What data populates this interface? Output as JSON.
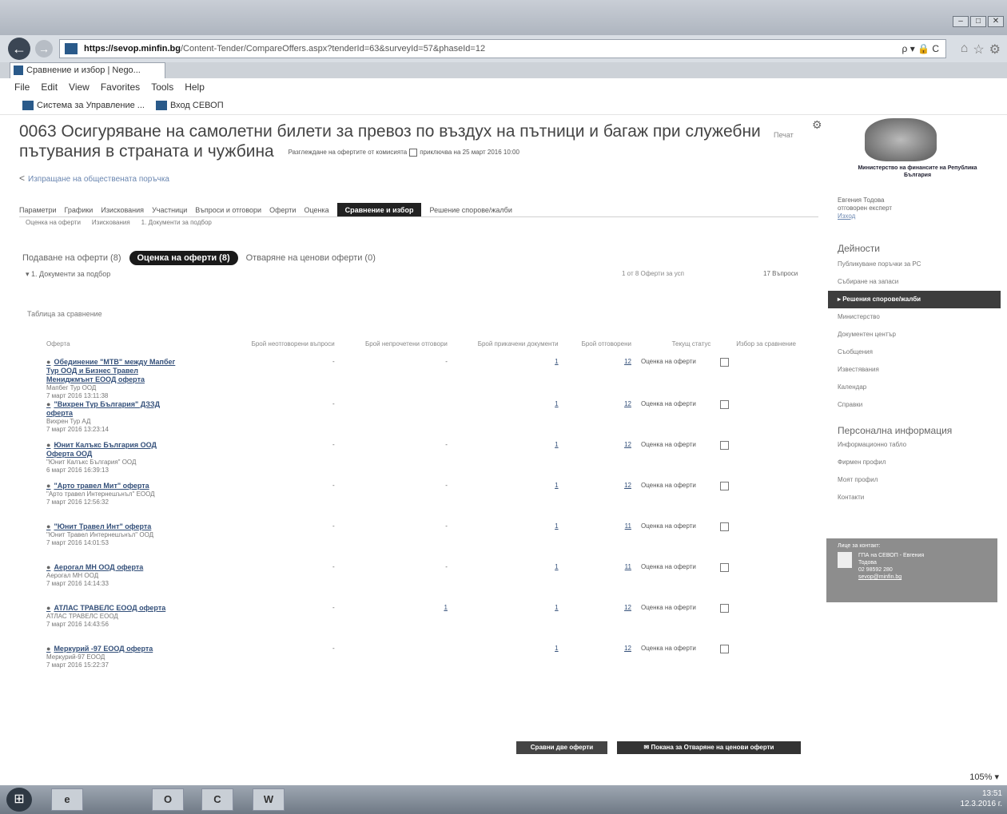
{
  "browser": {
    "url_host": "https://sevop.minfin.bg",
    "url_rest": "/Content-Tender/CompareOffers.aspx?tenderId=63&surveyId=57&phaseId=12",
    "url_tools": "ρ ▾ 🔒 C",
    "tab_title": "Сравнение и избор | Nego...",
    "menu": [
      "File",
      "Edit",
      "View",
      "Favorites",
      "Tools",
      "Help"
    ],
    "favorites": [
      "Система за Управление ...",
      "Вход СЕВОП"
    ],
    "zoom": "105%"
  },
  "page": {
    "title": "0063 Осигуряване на самолетни билети за превоз по въздух на пътници и багаж при служебни пътувания в страната и чужбина",
    "subline_a": "Разглеждане на офертите от комисията",
    "subline_b": "приключва на 25 март 2016 10:00",
    "print_link": "Печат",
    "share_link": "Изпращане на обществената поръчка",
    "tabs": [
      "Параметри",
      "Графики",
      "Изискования",
      "Участници",
      "Въпроси и отговори",
      "Оферти",
      "Оценка",
      "Сравнение и избор",
      "Решение спорове/жалби"
    ],
    "active_tab": "Сравнение и избор",
    "subtabs": [
      "Оценка на оферти",
      "Изискования",
      "1. Документи за подбор"
    ],
    "pills": {
      "submitted": "Подаване на оферти (8)",
      "evaluation": "Оценка на оферти (8)",
      "opening": "Отваряне на ценови оферти (0)"
    },
    "section": "1. Документи за подбор",
    "counter": "1 от 8 Оферти за усп",
    "downloads": "17 Въпроси",
    "table_title": "Таблица за сравнение"
  },
  "table": {
    "headers": [
      "Оферта",
      "Брой неотговорени въпроси",
      "Брой непрочетени отговори",
      "Брой прикачени документи",
      "Брой отговорени",
      "Текущ статус",
      "Избор за сравнение"
    ],
    "rows": [
      {
        "lines": [
          "Обединение \"МТВ\" между Мапбег",
          "Тур ООД и Бизнес Травел",
          "Мениджмънт ЕООД оферта"
        ],
        "company": "Мапбег Тур ООД",
        "date": "7 март 2016 13:11:38",
        "c1": "-",
        "c2": "-",
        "c3": "1",
        "c4": "12",
        "status": "Оценка на оферти"
      },
      {
        "lines": [
          "\"Вихрен Тур България\" ДЗЗД",
          "оферта"
        ],
        "company": "Вихрен Тур АД",
        "date": "7 март 2016 13:23:14",
        "c1": "-",
        "c2": "",
        "c3": "1",
        "c4": "12",
        "status": "Оценка на оферти"
      },
      {
        "lines": [
          "Юнит Калъкс България ООД",
          "Оферта ООД"
        ],
        "company": "\"Юнит Калъкс България\" ООД",
        "date": "6 март 2016 16:39:13",
        "c1": "-",
        "c2": "-",
        "c3": "1",
        "c4": "12",
        "status": "Оценка на оферти"
      },
      {
        "lines": [
          "\"Арто травел Мит\" оферта"
        ],
        "company": "\"Арто травел Интернешънъл\" ЕООД",
        "date": "7 март 2016 12:56:32",
        "c1": "-",
        "c2": "-",
        "c3": "1",
        "c4": "12",
        "status": "Оценка на оферти"
      },
      {
        "lines": [
          "\"Юнит Травел Инт\" оферта"
        ],
        "company": "\"Юнит Травел Интернешънъл\" ООД",
        "date": "7 март 2016 14:01:53",
        "c1": "-",
        "c2": "-",
        "c3": "1",
        "c4": "11",
        "status": "Оценка на оферти"
      },
      {
        "lines": [
          "Аерогал МН ООД оферта"
        ],
        "company": "Аерогал МН ООД",
        "date": "7 март 2016 14:14:33",
        "c1": "-",
        "c2": "-",
        "c3": "1",
        "c4": "11",
        "status": "Оценка на оферти"
      },
      {
        "lines": [
          "АТЛАС ТРАВЕЛС ЕООД оферта"
        ],
        "company": "АТЛАС ТРАВЕЛС ЕООД",
        "date": "7 март 2016 14:43:56",
        "c1": "-",
        "c2": "1",
        "c3": "1",
        "c4": "12",
        "status": "Оценка на оферти"
      },
      {
        "lines": [
          "Меркурий -97 ЕООД оферта"
        ],
        "company": "Меркурий-97 ЕООД",
        "date": "7 март 2016 15:22:37",
        "c1": "-",
        "c2": "",
        "c3": "1",
        "c4": "12",
        "status": "Оценка на оферти"
      }
    ]
  },
  "buttons": {
    "compare": "Сравни две оферти",
    "invite": "Покана за Отваряне на ценови оферти"
  },
  "sidebar": {
    "ministry": "Министерство на финансите на Република България",
    "user_name": "Евгения Тодова",
    "user_role": "отговорен експерт",
    "logout": "Изход",
    "activities_heading": "Дейности",
    "activities": [
      "Публикуване поръчки за РС",
      "Събиране на запаси",
      "Решения спорове/жалби",
      "Министерство",
      "Документен център",
      "Съобщения",
      "Известявания",
      "Календар",
      "Справки"
    ],
    "active_activity": "Решения спорове/жалби",
    "personal_heading": "Персонална информация",
    "personal": [
      "Информационно табло",
      "Фирмен профил",
      "Моят профил",
      "Контакти"
    ],
    "contact_title": "Лице за контакт:",
    "contact_lines": [
      "ГПА на СЕВОП - Евгения",
      "Тодова",
      "02 98592 280",
      "sevop@minfin.bg"
    ]
  },
  "taskbar": {
    "apps": [
      "e",
      "O",
      "C",
      "W"
    ],
    "time": "13:51",
    "date": "12.3.2016 г."
  }
}
